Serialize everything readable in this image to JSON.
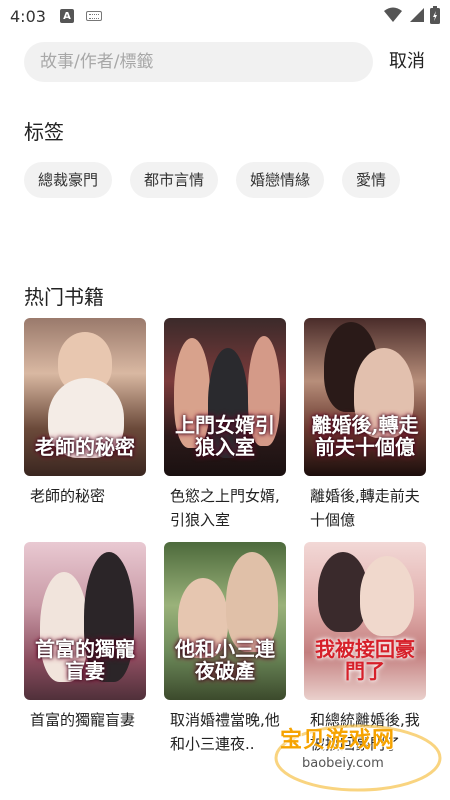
{
  "status_bar": {
    "time": "4:03",
    "notif_icon_letter": "A"
  },
  "search": {
    "placeholder": "故事/作者/標籤",
    "value": "",
    "cancel_label": "取消"
  },
  "tags_section": {
    "title": "标签",
    "tags": [
      "總裁豪門",
      "都市言情",
      "婚戀情緣",
      "愛情"
    ]
  },
  "hot_section": {
    "title": "热门书籍",
    "books": [
      {
        "name": "老師的秘密",
        "cover_title": "老師的秘密"
      },
      {
        "name": "色慾之上門女婿,引狼入室",
        "cover_title": "上門女婿引狼入室"
      },
      {
        "name": "離婚後,轉走前夫十個億",
        "cover_title": "離婚後,轉走前夫十個億"
      },
      {
        "name": "首富的獨寵盲妻",
        "cover_title": "首富的獨寵盲妻"
      },
      {
        "name": "取消婚禮當晚,他和小三連夜..",
        "cover_title": "他和小三連夜破產"
      },
      {
        "name": "和總統離婚後,我被接回豪門了",
        "cover_title": "我被接回豪門了"
      }
    ]
  },
  "watermark": {
    "text": "宝贝游戏网",
    "url": "baobeiy.com"
  },
  "colors": {
    "tag_bg": "#f2f2f2",
    "search_bg": "#f1f1f1",
    "watermark": "#f6a300"
  }
}
